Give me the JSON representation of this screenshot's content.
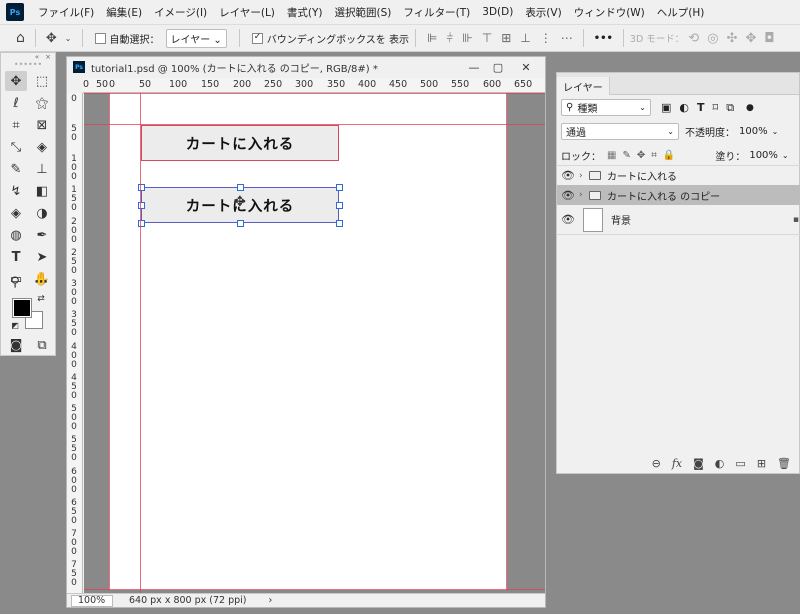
{
  "menu": {
    "logo": "Ps",
    "items": [
      "ファイル(F)",
      "編集(E)",
      "イメージ(I)",
      "レイヤー(L)",
      "書式(Y)",
      "選択範囲(S)",
      "フィルター(T)",
      "3D(D)",
      "表示(V)",
      "ウィンドウ(W)",
      "ヘルプ(H)"
    ]
  },
  "options": {
    "auto_select_label": "自動選択：",
    "auto_select_target": "レイヤー",
    "bounding_box_label": "バウンディングボックスを 表示",
    "mode_3d_label": "3D モード：",
    "more": "•••"
  },
  "document": {
    "title": "tutorial1.psd @ 100% (カートに入れる のコピー, RGB/8#) *",
    "ruler_h": [
      "0",
      "50",
      "0",
      "50",
      "100",
      "150",
      "200",
      "250",
      "300",
      "350",
      "400",
      "450",
      "500",
      "550",
      "600",
      "650"
    ],
    "ruler_v": [
      "0",
      "5 0",
      "1 0 0",
      "1 5 0",
      "2 0 0",
      "2 5 0",
      "3 0 0",
      "3 5 0",
      "4 0 0",
      "4 5 0",
      "5 0 0",
      "5 5 0",
      "6 0 0",
      "6 5 0",
      "7 0 0",
      "7 5 0"
    ],
    "buttons": [
      "カートに入れる",
      "カートに入れる"
    ],
    "zoom": "100%",
    "dimensions": "640 px x 800 px (72 ppi)",
    "status_arrow": "›"
  },
  "layers": {
    "tab": "レイヤー",
    "filter_kind": "種類",
    "blend_mode": "通過",
    "opacity_label": "不透明度：",
    "opacity_value": "100%",
    "lock_label": "ロック：",
    "fill_label": "塗り：",
    "fill_value": "100%",
    "items": [
      {
        "name": "カートに入れる",
        "type": "folder",
        "selected": false
      },
      {
        "name": "カートに入れる のコピー",
        "type": "folder",
        "selected": true
      },
      {
        "name": "背景",
        "type": "background",
        "selected": false
      }
    ],
    "footer_icons": [
      "link-icon",
      "fx-icon",
      "mask-icon",
      "adjustment-icon",
      "group-icon",
      "new-layer-icon",
      "trash-icon"
    ],
    "fx_label": "fx"
  }
}
